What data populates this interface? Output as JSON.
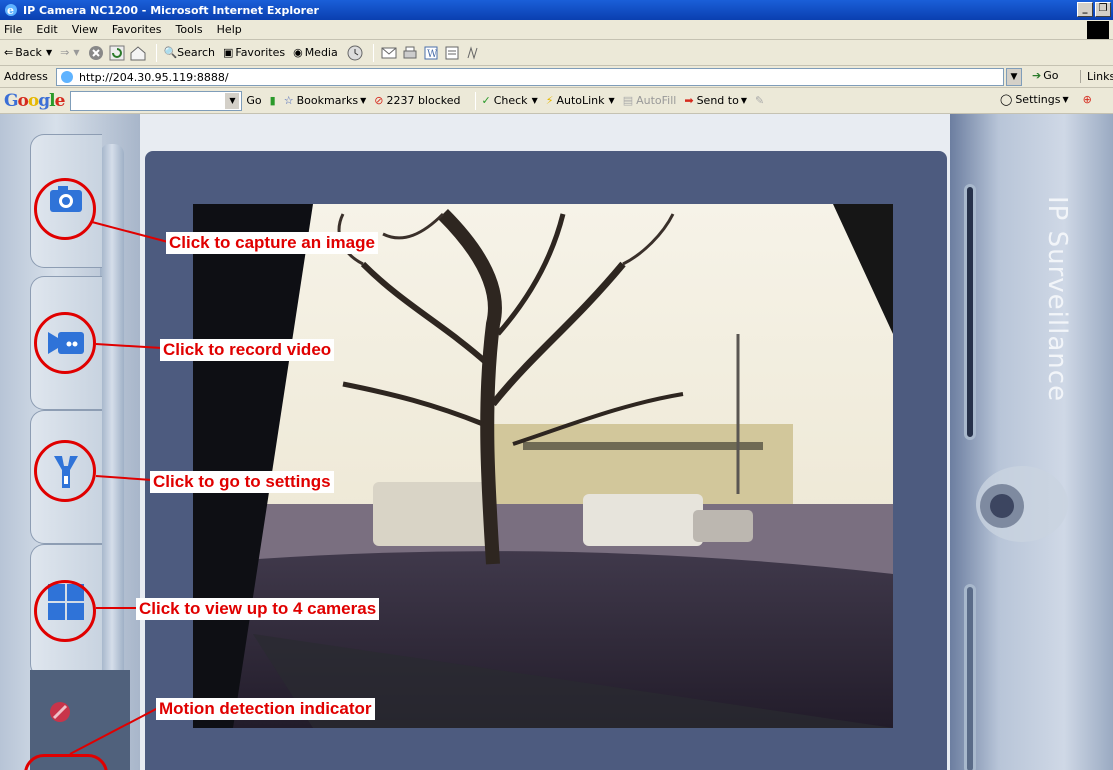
{
  "window": {
    "title": "IP Camera NC1200 - Microsoft Internet Explorer",
    "min": "_",
    "max": "ıı"
  },
  "menu": [
    "File",
    "Edit",
    "View",
    "Favorites",
    "Tools",
    "Help"
  ],
  "toolbar": {
    "back": "Back",
    "search": "Search",
    "favorites": "Favorites",
    "media": "Media"
  },
  "address": {
    "label": "Address",
    "url": "http://204.30.95.119:8888/",
    "go": "Go",
    "links": "Links"
  },
  "google": {
    "logo": "Google",
    "go": "Go",
    "bookmarks": "Bookmarks",
    "blocked": "2237 blocked",
    "check": "Check",
    "autolink": "AutoLink",
    "autofill": "AutoFill",
    "sendto": "Send to",
    "settings": "Settings"
  },
  "brand": "IP Surveillance",
  "annotations": {
    "capture": "Click to capture an image",
    "record": "Click to record video",
    "settings": "Click to go to settings",
    "view4": "Click to view up to 4 cameras",
    "motion": "Motion detection indicator"
  },
  "colors": {
    "annotation": "#e00000",
    "panel": "#4d5b7f",
    "titlebar": "#0a3fb0"
  }
}
